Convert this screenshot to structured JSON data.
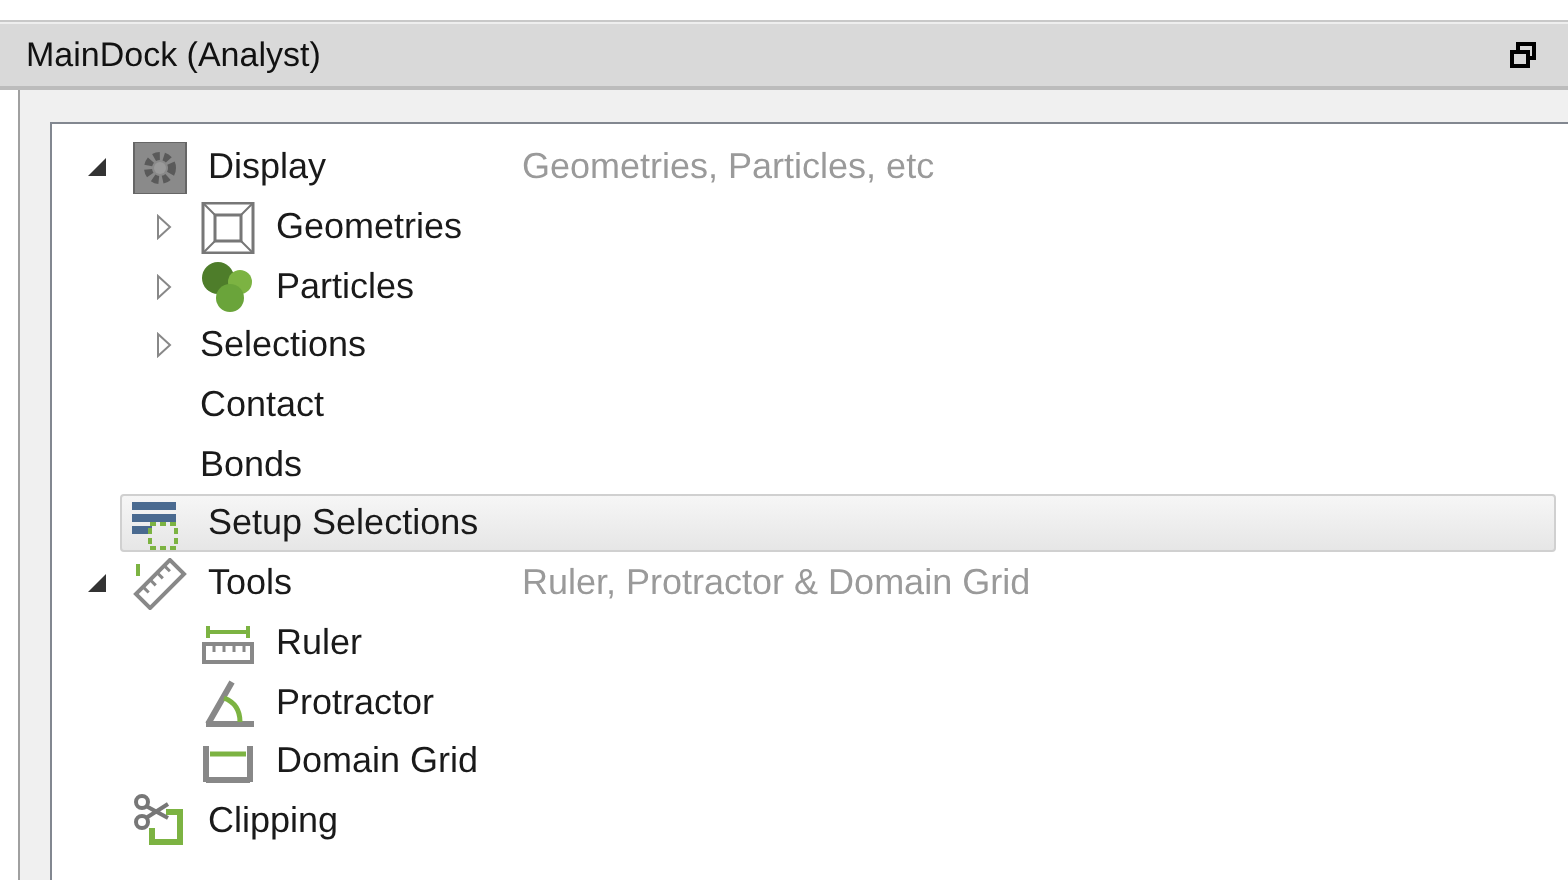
{
  "window": {
    "title": "MainDock (Analyst)"
  },
  "tree": [
    {
      "label": "Display",
      "description": "Geometries, Particles, etc",
      "expanded": true,
      "selected": false,
      "children": [
        {
          "label": "Geometries",
          "expanded": false,
          "selected": false
        },
        {
          "label": "Particles",
          "expanded": false,
          "selected": false
        },
        {
          "label": "Selections",
          "expanded": false,
          "selected": false
        },
        {
          "label": "Contact",
          "selected": false
        },
        {
          "label": "Bonds",
          "selected": false
        }
      ]
    },
    {
      "label": "Setup Selections",
      "selected": true
    },
    {
      "label": "Tools",
      "description": "Ruler, Protractor & Domain Grid",
      "expanded": true,
      "selected": false,
      "children": [
        {
          "label": "Ruler",
          "selected": false
        },
        {
          "label": "Protractor",
          "selected": false
        },
        {
          "label": "Domain Grid",
          "selected": false
        }
      ]
    },
    {
      "label": "Clipping",
      "selected": false
    }
  ]
}
